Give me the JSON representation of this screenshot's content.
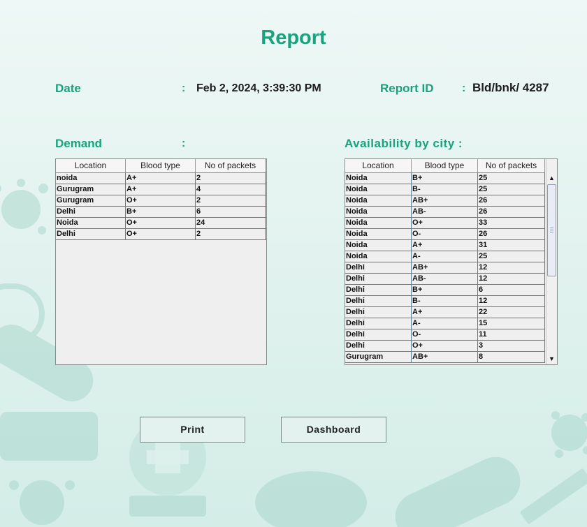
{
  "report": {
    "title": "Report",
    "date_label": "Date",
    "date_value": "Feb 2, 2024, 3:39:30 PM",
    "report_id_label": "Report ID",
    "report_id_value": "Bld/bnk/ 4287",
    "colon": ":"
  },
  "demand": {
    "label": "Demand",
    "columns": [
      "Location",
      "Blood type",
      "No of packets"
    ],
    "rows": [
      [
        "noida",
        "A+",
        "2"
      ],
      [
        "Gurugram",
        "A+",
        "4"
      ],
      [
        "Gurugram",
        "O+",
        "2"
      ],
      [
        "Delhi",
        "B+",
        "6"
      ],
      [
        "Noida",
        "O+",
        "24"
      ],
      [
        "Delhi",
        "O+",
        "2"
      ]
    ]
  },
  "availability": {
    "label": "Availability by city :",
    "columns": [
      "Location",
      "Blood type",
      "No of packets"
    ],
    "rows": [
      [
        "Noida",
        "B+",
        "25"
      ],
      [
        "Noida",
        "B-",
        "25"
      ],
      [
        "Noida",
        "AB+",
        "26"
      ],
      [
        "Noida",
        "AB-",
        "26"
      ],
      [
        "Noida",
        "O+",
        "33"
      ],
      [
        "Noida",
        "O-",
        "26"
      ],
      [
        "Noida",
        "A+",
        "31"
      ],
      [
        "Noida",
        "A-",
        "25"
      ],
      [
        "Delhi",
        "AB+",
        "12"
      ],
      [
        "Delhi",
        "AB-",
        "12"
      ],
      [
        "Delhi",
        "B+",
        "6"
      ],
      [
        "Delhi",
        "B-",
        "12"
      ],
      [
        "Delhi",
        "A+",
        "22"
      ],
      [
        "Delhi",
        "A-",
        "15"
      ],
      [
        "Delhi",
        "O-",
        "11"
      ],
      [
        "Delhi",
        "O+",
        "3"
      ],
      [
        "Gurugram",
        "AB+",
        "8"
      ]
    ]
  },
  "buttons": {
    "print": "Print",
    "dashboard": "Dashboard"
  },
  "icons": {
    "scroll_up": "▲",
    "scroll_down": "▼"
  },
  "colors": {
    "accent": "#1aa17e",
    "background": "#e3f3ef",
    "decor": "#9fd3c8"
  }
}
